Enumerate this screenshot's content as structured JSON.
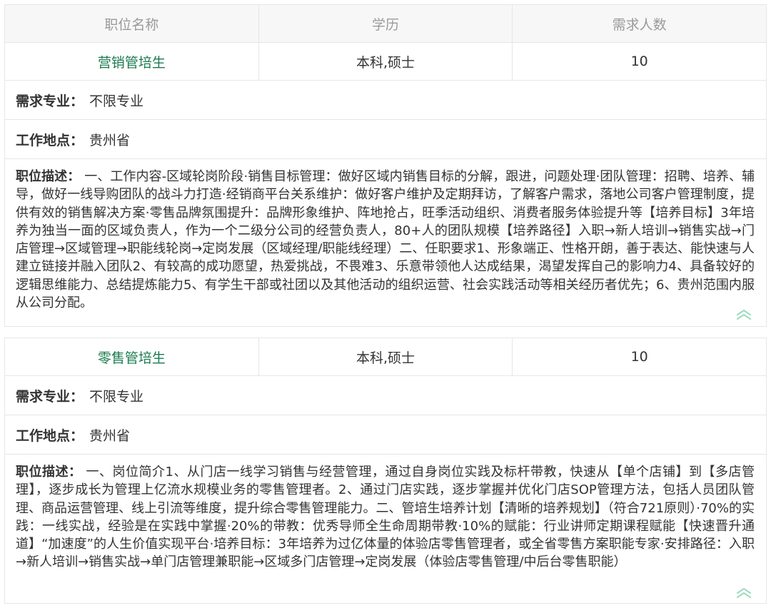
{
  "header": {
    "col1": "职位名称",
    "col2": "学历",
    "col3": "需求人数"
  },
  "jobs": [
    {
      "title": "营销管培生",
      "education": "本科,硕士",
      "count": "10",
      "major_label": "需求专业：",
      "major": "不限专业",
      "location_label": "工作地点：",
      "location": "贵州省",
      "desc_label": "职位描述：",
      "desc": "一、工作内容-区域轮岗阶段·销售目标管理：做好区域内销售目标的分解，跟进，问题处理·团队管理：招聘、培养、辅导，做好一线导购团队的战斗力打造·经销商平台关系维护：做好客户维护及定期拜访，了解客户需求，落地公司客户管理制度，提供有效的销售解决方案·零售品牌氛围提升：品牌形象维护、阵地抢占，旺季活动组织、消费者服务体验提升等【培养目标】3年培养为独当一面的区域负责人，作为一个二级分公司的经营负责人，80+人的团队规模【培养路径】入职→新人培训→销售实战→门店管理→区域管理→职能线轮岗→定岗发展（区域经理/职能线经理）二、任职要求1、形象端正、性格开朗，善于表达、能快速与人建立链接并融入团队2、有较高的成功愿望，热爱挑战，不畏难3、乐意带领他人达成结果，渴望发挥自己的影响力4、具备较好的逻辑思维能力、总结提炼能力5、有学生干部或社团以及其他活动的组织运营、社会实践活动等相关经历者优先；6、贵州范围内服从公司分配。",
      "collapse_icon": "double-chevron-up"
    },
    {
      "title": "零售管培生",
      "education": "本科,硕士",
      "count": "10",
      "major_label": "需求专业：",
      "major": "不限专业",
      "location_label": "工作地点：",
      "location": "贵州省",
      "desc_label": "职位描述：",
      "desc": "一、岗位简介1、从门店一线学习销售与经营管理，通过自身岗位实践及标杆带教，快速从【单个店铺】到【多店管理】，逐步成长为管理上亿流水规模业务的零售管理者。2、通过门店实践，逐步掌握并优化门店SOP管理方法，包括人员团队管理、商品运营管理、线上引流等维度，提升综合零售管理能力。二、管培生培养计划【清晰的培养规划】（符合721原则）·70%的实践：一线实战，经验是在实践中掌握·20%的带教：优秀导师全生命周期带教·10%的赋能：行业讲师定期课程赋能【快速晋升通道】“加速度”的人生价值实现平台·培养目标：3年培养为过亿体量的体验店零售管理者，或全省零售方案职能专家·安排路径：入职→新人培训→销售实战→单门店管理兼职能→区域多门店管理→定岗发展（体验店零售管理/中后台零售职能）",
      "collapse_icon": "double-chevron-up"
    }
  ],
  "colors": {
    "accent": "#1a7a4f",
    "icon": "#9fdcbf",
    "border": "#e6e6e6",
    "header_bg": "#f7f7f7"
  }
}
